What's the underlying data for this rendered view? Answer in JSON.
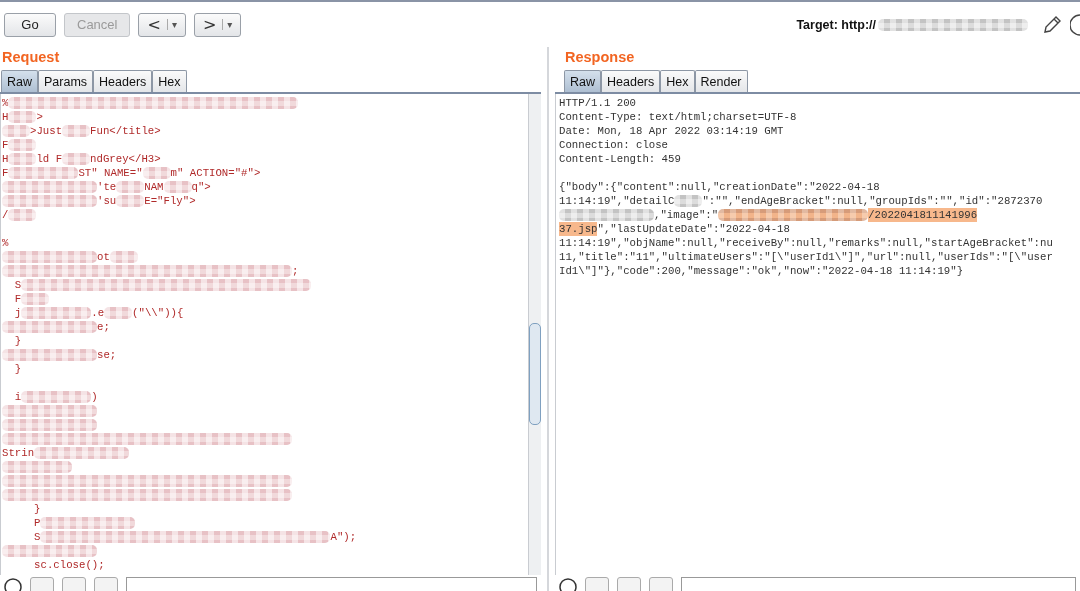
{
  "toolbar": {
    "buttons": [
      {
        "label": "Go",
        "disabled": false
      },
      {
        "label": "Cancel",
        "disabled": true
      }
    ],
    "history": [
      {
        "arrow": "<",
        "caret": "▾"
      },
      {
        "arrow": ">",
        "caret": "▾"
      }
    ],
    "target": {
      "label": "Target: http://",
      "masked": true
    }
  },
  "request": {
    "title": "Request",
    "tabs": [
      {
        "label": "Raw",
        "selected": true
      },
      {
        "label": "Params",
        "selected": false
      },
      {
        "label": "Headers",
        "selected": false
      },
      {
        "label": "Hex",
        "selected": false
      }
    ],
    "lines": [
      {
        "kind": "code",
        "segments": [
          {
            "kind": "text",
            "text": "%"
          },
          {
            "kind": "mosaicXL"
          }
        ]
      },
      {
        "kind": "code",
        "segments": [
          {
            "kind": "text",
            "text": "H"
          },
          {
            "kind": "mosaicS"
          },
          {
            "kind": "text",
            "text": ">"
          }
        ]
      },
      {
        "kind": "code",
        "segments": [
          {
            "kind": "mosaicS"
          },
          {
            "kind": "text",
            "text": ">Just"
          },
          {
            "kind": "mosaicS"
          },
          {
            "kind": "text",
            "text": "Fun</title>"
          }
        ]
      },
      {
        "kind": "code",
        "segments": [
          {
            "kind": "text",
            "text": "F"
          },
          {
            "kind": "mosaicS"
          }
        ]
      },
      {
        "kind": "code",
        "segments": [
          {
            "kind": "text",
            "text": "H"
          },
          {
            "kind": "mosaicS"
          },
          {
            "kind": "text",
            "text": "ld F"
          },
          {
            "kind": "mosaicS"
          },
          {
            "kind": "text",
            "text": "ndGrey</H3>"
          }
        ]
      },
      {
        "kind": "code",
        "segments": [
          {
            "kind": "text",
            "text": "F"
          },
          {
            "kind": "mosaicM"
          },
          {
            "kind": "text",
            "text": "ST\" NAME=\""
          },
          {
            "kind": "mosaicS"
          },
          {
            "kind": "text",
            "text": "m\" ACTION=\"#\">"
          }
        ]
      },
      {
        "kind": "code",
        "segments": [
          {
            "kind": "mosaicL"
          },
          {
            "kind": "text",
            "text": "'te"
          },
          {
            "kind": "mosaicS"
          },
          {
            "kind": "text",
            "text": "NAM"
          },
          {
            "kind": "mosaicS"
          },
          {
            "kind": "text",
            "text": "q\">"
          }
        ]
      },
      {
        "kind": "code",
        "segments": [
          {
            "kind": "mosaicL"
          },
          {
            "kind": "text",
            "text": "'su"
          },
          {
            "kind": "mosaicS"
          },
          {
            "kind": "text",
            "text": "E=\"Fly\">"
          }
        ]
      },
      {
        "kind": "code",
        "segments": [
          {
            "kind": "text",
            "text": "/"
          },
          {
            "kind": "mosaicS"
          }
        ]
      },
      {
        "kind": "blank"
      },
      {
        "kind": "code",
        "segments": [
          {
            "kind": "text",
            "text": "%"
          }
        ]
      },
      {
        "kind": "code",
        "segments": [
          {
            "kind": "mosaicL"
          },
          {
            "kind": "text",
            "text": "ot"
          },
          {
            "kind": "mosaicS"
          }
        ]
      },
      {
        "kind": "code",
        "segments": [
          {
            "kind": "mosaicXL"
          },
          {
            "kind": "text",
            "text": ";"
          }
        ]
      },
      {
        "kind": "code",
        "segments": [
          {
            "kind": "text",
            "text": "  S"
          },
          {
            "kind": "mosaicXL"
          }
        ]
      },
      {
        "kind": "code",
        "segments": [
          {
            "kind": "text",
            "text": "  F"
          },
          {
            "kind": "mosaicS"
          }
        ]
      },
      {
        "kind": "code",
        "segments": [
          {
            "kind": "text",
            "text": "  j"
          },
          {
            "kind": "mosaicM"
          },
          {
            "kind": "text",
            "text": ".e"
          },
          {
            "kind": "mosaicS"
          },
          {
            "kind": "text",
            "text": "(\"\\\\\")){"
          }
        ]
      },
      {
        "kind": "code",
        "segments": [
          {
            "kind": "mosaicL"
          },
          {
            "kind": "text",
            "text": "e;"
          }
        ]
      },
      {
        "kind": "code",
        "segments": [
          {
            "kind": "text",
            "text": "  }"
          }
        ]
      },
      {
        "kind": "code",
        "segments": [
          {
            "kind": "mosaicL"
          },
          {
            "kind": "text",
            "text": "se;"
          }
        ]
      },
      {
        "kind": "code",
        "segments": [
          {
            "kind": "text",
            "text": "  }"
          }
        ]
      },
      {
        "kind": "blank"
      },
      {
        "kind": "code",
        "segments": [
          {
            "kind": "text",
            "text": "  i"
          },
          {
            "kind": "mosaicM"
          },
          {
            "kind": "text",
            "text": ")"
          }
        ]
      },
      {
        "kind": "code",
        "segments": [
          {
            "kind": "mosaicL"
          }
        ]
      },
      {
        "kind": "code",
        "segments": [
          {
            "kind": "mosaicL"
          }
        ]
      },
      {
        "kind": "code",
        "segments": [
          {
            "kind": "mosaicXL"
          }
        ]
      },
      {
        "kind": "code",
        "segments": [
          {
            "kind": "text",
            "text": "Strin"
          },
          {
            "kind": "mosaicL"
          }
        ]
      },
      {
        "kind": "code",
        "segments": [
          {
            "kind": "mosaicM"
          }
        ]
      },
      {
        "kind": "code",
        "segments": [
          {
            "kind": "mosaicXL"
          }
        ]
      },
      {
        "kind": "code",
        "segments": [
          {
            "kind": "mosaicXL"
          }
        ]
      },
      {
        "kind": "code",
        "segments": [
          {
            "kind": "text",
            "text": "     }"
          }
        ]
      },
      {
        "kind": "code",
        "segments": [
          {
            "kind": "text",
            "text": "     P"
          },
          {
            "kind": "mosaicL"
          }
        ]
      },
      {
        "kind": "code",
        "segments": [
          {
            "kind": "text",
            "text": "     S"
          },
          {
            "kind": "mosaicXL"
          },
          {
            "kind": "text",
            "text": "A\");"
          }
        ]
      },
      {
        "kind": "code",
        "segments": [
          {
            "kind": "mosaicL"
          }
        ]
      },
      {
        "kind": "code",
        "segments": [
          {
            "kind": "text",
            "text": "     sc.close();"
          }
        ]
      }
    ]
  },
  "response": {
    "title": "Response",
    "tabs": [
      {
        "label": "Raw",
        "selected": true
      },
      {
        "label": "Headers",
        "selected": false
      },
      {
        "label": "Hex",
        "selected": false
      },
      {
        "label": "Render",
        "selected": false
      }
    ],
    "lines": [
      {
        "kind": "code",
        "segments": [
          {
            "kind": "text",
            "text": "HTTP/1.1 200"
          }
        ]
      },
      {
        "kind": "code",
        "segments": [
          {
            "kind": "text",
            "text": "Content-Type: text/html;charset=UTF-8"
          }
        ]
      },
      {
        "kind": "code",
        "segments": [
          {
            "kind": "text",
            "text": "Date: Mon, 18 Apr 2022 03:14:19 GMT"
          }
        ]
      },
      {
        "kind": "code",
        "segments": [
          {
            "kind": "text",
            "text": "Connection: close"
          }
        ]
      },
      {
        "kind": "code",
        "segments": [
          {
            "kind": "text",
            "text": "Content-Length: 459"
          }
        ]
      },
      {
        "kind": "blank"
      },
      {
        "kind": "code",
        "segments": [
          {
            "kind": "text",
            "text": "{\"body\":{\"content\":null,\"creationDate\":\"2022-04-18"
          }
        ]
      },
      {
        "kind": "code",
        "segments": [
          {
            "kind": "text",
            "text": "11:14:19\",\"detailC"
          },
          {
            "kind": "mosaicS"
          },
          {
            "kind": "text",
            "text": "\":\"\",\"endAgeBracket\":null,\"groupIds\":\"\",\"id\":\"2872370"
          }
        ]
      },
      {
        "kind": "code",
        "segments": [
          {
            "kind": "mosaicL"
          },
          {
            "kind": "text",
            "text": ",\"image\":\""
          },
          {
            "kind": "markedmosaic"
          },
          {
            "kind": "marked",
            "text": "/2022041811141996"
          }
        ]
      },
      {
        "kind": "code",
        "segments": [
          {
            "kind": "marked",
            "text": "37.jsp"
          },
          {
            "kind": "text",
            "text": "\",\"lastUpdateDate\":\"2022-04-18"
          }
        ]
      },
      {
        "kind": "code",
        "segments": [
          {
            "kind": "text",
            "text": "11:14:19\",\"objName\":null,\"receiveBy\":null,\"remarks\":null,\"startAgeBracket\":nu"
          }
        ]
      },
      {
        "kind": "code",
        "segments": [
          {
            "kind": "text",
            "text": "11,\"title\":\"11\",\"ultimateUsers\":\"[\\\"userId1\\\"]\",\"url\":null,\"userIds\":\"[\\\"user"
          }
        ]
      },
      {
        "kind": "code",
        "segments": [
          {
            "kind": "text",
            "text": "Id1\\\"]\"},\"code\":200,\"message\":\"ok\",\"now\":\"2022-04-18 11:14:19\"}"
          }
        ]
      }
    ]
  }
}
